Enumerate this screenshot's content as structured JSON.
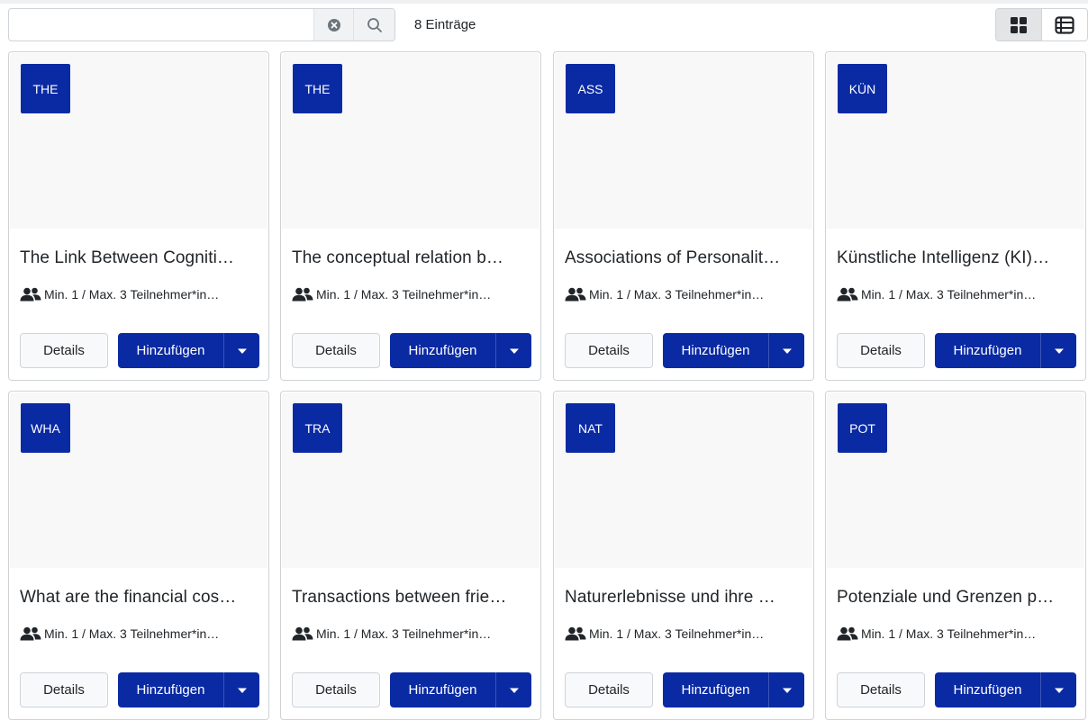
{
  "search": {
    "value": "",
    "placeholder": ""
  },
  "result_count": "8 Einträge",
  "icons": {
    "clear": "circle-x-icon",
    "search": "search-icon",
    "grid_view": "grid-view-icon",
    "list_view": "list-view-icon",
    "participants": "people-icon",
    "dropdown": "caret-down-icon"
  },
  "colors": {
    "brand": "#0a2aa3",
    "media_bg": "#f8f8f9"
  },
  "cards": [
    {
      "badge": "THE",
      "title": "The Link Between Cogniti…",
      "meta": "Min. 1 / Max. 3 Teilnehmer*in…",
      "details_label": "Details",
      "add_label": "Hinzufügen"
    },
    {
      "badge": "THE",
      "title": "The conceptual relation b…",
      "meta": "Min. 1 / Max. 3 Teilnehmer*in…",
      "details_label": "Details",
      "add_label": "Hinzufügen"
    },
    {
      "badge": "ASS",
      "title": "Associations of Personalit…",
      "meta": "Min. 1 / Max. 3 Teilnehmer*in…",
      "details_label": "Details",
      "add_label": "Hinzufügen"
    },
    {
      "badge": "KÜN",
      "title": "Künstliche Intelligenz (KI)…",
      "meta": "Min. 1 / Max. 3 Teilnehmer*in…",
      "details_label": "Details",
      "add_label": "Hinzufügen"
    },
    {
      "badge": "WHA",
      "title": "What are the financial cos…",
      "meta": "Min. 1 / Max. 3 Teilnehmer*in…",
      "details_label": "Details",
      "add_label": "Hinzufügen"
    },
    {
      "badge": "TRA",
      "title": "Transactions between frie…",
      "meta": "Min. 1 / Max. 3 Teilnehmer*in…",
      "details_label": "Details",
      "add_label": "Hinzufügen"
    },
    {
      "badge": "NAT",
      "title": "Naturerlebnisse und ihre …",
      "meta": "Min. 1 / Max. 3 Teilnehmer*in…",
      "details_label": "Details",
      "add_label": "Hinzufügen"
    },
    {
      "badge": "POT",
      "title": "Potenziale und Grenzen p…",
      "meta": "Min. 1 / Max. 3 Teilnehmer*in…",
      "details_label": "Details",
      "add_label": "Hinzufügen"
    }
  ]
}
